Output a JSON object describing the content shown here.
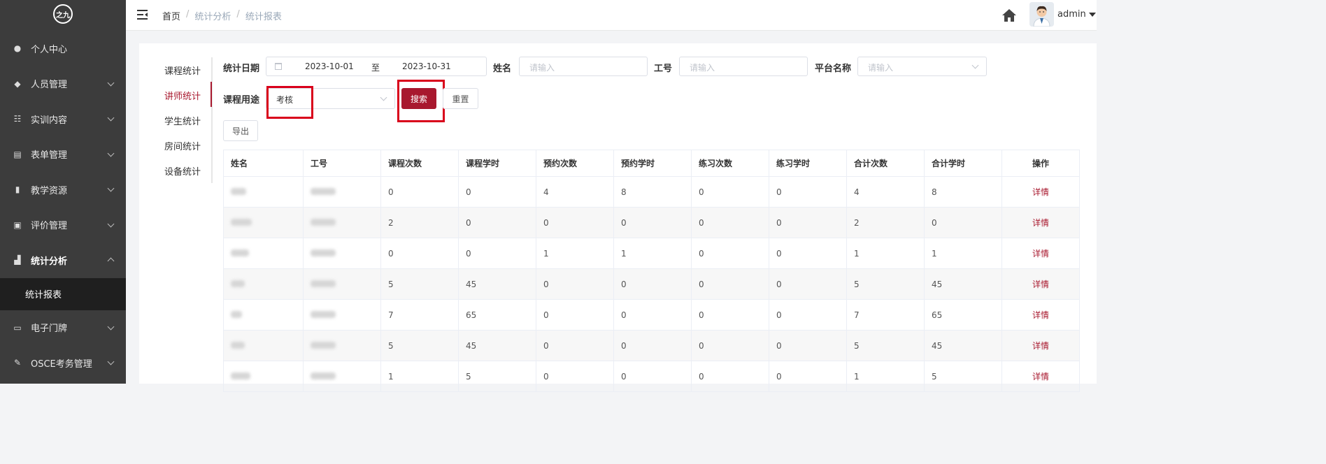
{
  "logo": {
    "text": "之九"
  },
  "sidebar": {
    "items": [
      {
        "label": "个人中心",
        "icon": "user-icon",
        "arrow": "none"
      },
      {
        "label": "人员管理",
        "icon": "users-icon",
        "arrow": "down"
      },
      {
        "label": "实训内容",
        "icon": "content-icon",
        "arrow": "down"
      },
      {
        "label": "表单管理",
        "icon": "form-icon",
        "arrow": "down"
      },
      {
        "label": "教学资源",
        "icon": "resource-icon",
        "arrow": "down"
      },
      {
        "label": "评价管理",
        "icon": "evaluation-icon",
        "arrow": "down"
      },
      {
        "label": "统计分析",
        "icon": "bar-chart-icon",
        "arrow": "up",
        "active": true
      },
      {
        "label": "电子门牌",
        "icon": "doorplate-icon",
        "arrow": "down"
      },
      {
        "label": "OSCE考务管理",
        "icon": "edit-icon",
        "arrow": "down"
      }
    ],
    "submenu": {
      "label": "统计报表"
    }
  },
  "topbar": {
    "breadcrumb": [
      "首页",
      "统计分析",
      "统计报表"
    ],
    "separator": "/",
    "user": "admin"
  },
  "subnav": {
    "items": [
      "课程统计",
      "讲师统计",
      "学生统计",
      "房间统计",
      "设备统计"
    ],
    "active_index": 1
  },
  "filters": {
    "date_label": "统计日期",
    "date_start": "2023-10-01",
    "date_to": "至",
    "date_end": "2023-10-31",
    "name_label": "姓名",
    "name_placeholder": "请输入",
    "id_label": "工号",
    "id_placeholder": "请输入",
    "platform_label": "平台名称",
    "platform_placeholder": "请输入",
    "purpose_label": "课程用途",
    "purpose_value": "考核"
  },
  "buttons": {
    "search": "搜索",
    "reset": "重置",
    "export": "导出"
  },
  "table": {
    "headers": [
      "姓名",
      "工号",
      "课程次数",
      "课程学时",
      "预约次数",
      "预约学时",
      "练习次数",
      "练习学时",
      "合计次数",
      "合计学时",
      "操作"
    ],
    "rows": [
      [
        "0",
        "0",
        "4",
        "8",
        "0",
        "0",
        "4",
        "8"
      ],
      [
        "2",
        "0",
        "0",
        "0",
        "0",
        "0",
        "2",
        "0"
      ],
      [
        "0",
        "0",
        "1",
        "1",
        "0",
        "0",
        "1",
        "1"
      ],
      [
        "5",
        "45",
        "0",
        "0",
        "0",
        "0",
        "5",
        "45"
      ],
      [
        "7",
        "65",
        "0",
        "0",
        "0",
        "0",
        "7",
        "65"
      ],
      [
        "5",
        "45",
        "0",
        "0",
        "0",
        "0",
        "5",
        "45"
      ],
      [
        "1",
        "5",
        "0",
        "0",
        "0",
        "0",
        "1",
        "5"
      ]
    ],
    "action_label": "详情"
  },
  "colors": {
    "sidebar_bg": "#3c3c3c",
    "submenu_bg": "#1f1f1f",
    "accent": "#a8182e",
    "highlight": "#d9001b"
  }
}
